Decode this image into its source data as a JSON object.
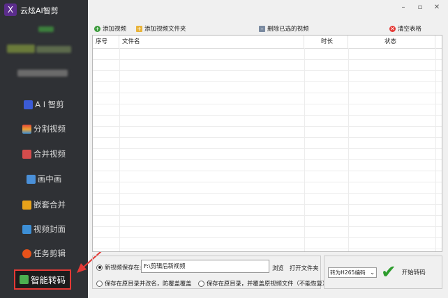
{
  "app": {
    "logo": "X",
    "title": "云炫AI智剪"
  },
  "window": {
    "min": "–",
    "max": "▫",
    "close": "✕"
  },
  "sidebar": {
    "items": [
      {
        "label": "A I 智剪",
        "icon": "ai-icon",
        "color": "#3b5bd6"
      },
      {
        "label": "分割视频",
        "icon": "split-icon",
        "color": "#e0453a"
      },
      {
        "label": "合并视频",
        "icon": "merge-icon",
        "color": "#d44c4c"
      },
      {
        "label": "画中画",
        "icon": "pip-icon",
        "color": "#4a90d9"
      },
      {
        "label": "嵌套合并",
        "icon": "nest-icon",
        "color": "#e8a21a"
      },
      {
        "label": "视频封面",
        "icon": "cover-icon",
        "color": "#3d8fd6"
      },
      {
        "label": "任务剪辑",
        "icon": "task-icon",
        "color": "#e8521a"
      },
      {
        "label": "智能转码",
        "icon": "transcode-icon",
        "color": "#4caf50",
        "active": true
      }
    ]
  },
  "toolbar": {
    "add_video": "添加视频",
    "add_folder": "添加视频文件夹",
    "delete_selected": "删除已选的视频",
    "clear_table": "清空表格"
  },
  "table": {
    "columns": [
      "序号",
      "文件名",
      "时长",
      "状态"
    ]
  },
  "output": {
    "new_save_label": "新视频保存在:",
    "path": "F:\\剪辑后新视频",
    "browse": "浏览",
    "open_folder": "打开文件夹",
    "keep_rename": "保存在原目录并改名，防覆盖覆盖",
    "overwrite": "保存在原目录，并覆盖原视频文件（不能恢复）"
  },
  "codec": {
    "selected": "转为H265编码"
  },
  "start": {
    "label": "开始转码"
  },
  "colors": {
    "sidebar_bg": "#2f3135",
    "highlight": "#e53935",
    "check": "#2e9d2e"
  }
}
